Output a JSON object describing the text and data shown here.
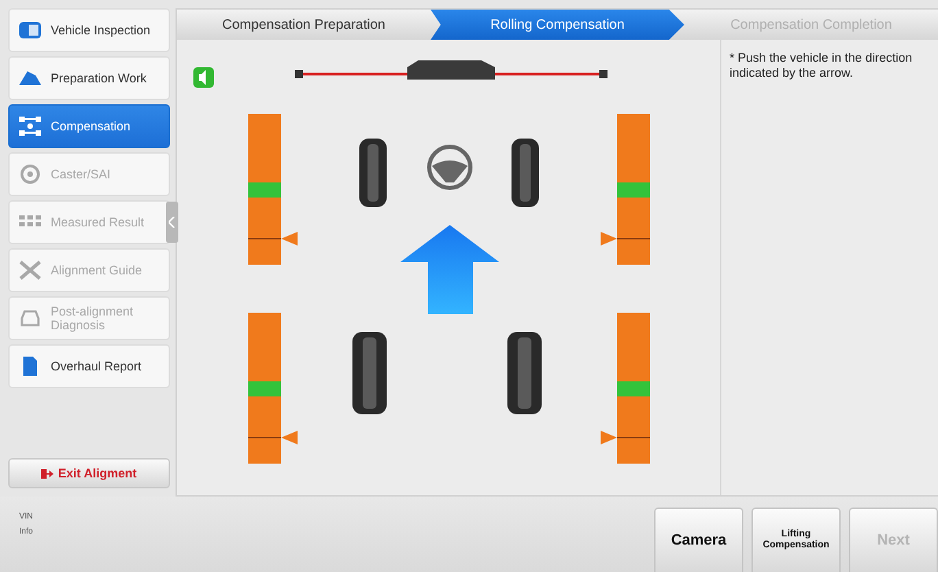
{
  "sidebar": {
    "items": [
      {
        "label": "Vehicle Inspection",
        "selected": false,
        "disabled": false
      },
      {
        "label": "Preparation Work",
        "selected": false,
        "disabled": false
      },
      {
        "label": "Compensation",
        "selected": true,
        "disabled": false
      },
      {
        "label": "Caster/SAI",
        "selected": false,
        "disabled": true
      },
      {
        "label": "Measured Result",
        "selected": false,
        "disabled": true
      },
      {
        "label": "Alignment Guide",
        "selected": false,
        "disabled": true
      },
      {
        "label": "Post-alignment Diagnosis",
        "selected": false,
        "disabled": true
      },
      {
        "label": "Overhaul Report",
        "selected": false,
        "disabled": false
      }
    ],
    "exit_button": "Exit Aligment"
  },
  "steps": [
    {
      "label": "Compensation Preparation",
      "selected": false,
      "disabled": false
    },
    {
      "label": "Rolling Compensation",
      "selected": true,
      "disabled": false
    },
    {
      "label": "Compensation Completion",
      "selected": false,
      "disabled": true
    }
  ],
  "instruction": "* Push the vehicle in the direction indicated by the arrow.",
  "status_bar": {
    "lines": [
      "VIN",
      "Info"
    ]
  },
  "buttons": [
    {
      "label": "Camera",
      "disabled": false,
      "kind": "large"
    },
    {
      "label": "Lifting Compensation",
      "disabled": false,
      "kind": "small"
    },
    {
      "label": "Next",
      "disabled": true,
      "kind": "large"
    }
  ]
}
